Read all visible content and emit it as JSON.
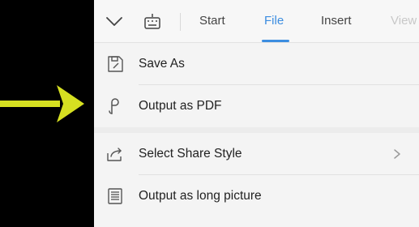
{
  "toolbar": {
    "tabs": [
      "Start",
      "File",
      "Insert",
      "View"
    ],
    "active_tab": "File",
    "icons": [
      "chevron-down-icon",
      "keyboard-icon"
    ]
  },
  "menu": {
    "items": [
      {
        "label": "Save As",
        "icon": "save-as-icon"
      },
      {
        "label": "Output as PDF",
        "icon": "pdf-icon"
      },
      {
        "label": "Select Share Style",
        "icon": "share-icon",
        "has_submenu": true
      },
      {
        "label": "Output as long picture",
        "icon": "long-picture-icon"
      }
    ]
  },
  "colors": {
    "accent": "#3c8de0",
    "annotation_arrow": "#d6e021"
  }
}
